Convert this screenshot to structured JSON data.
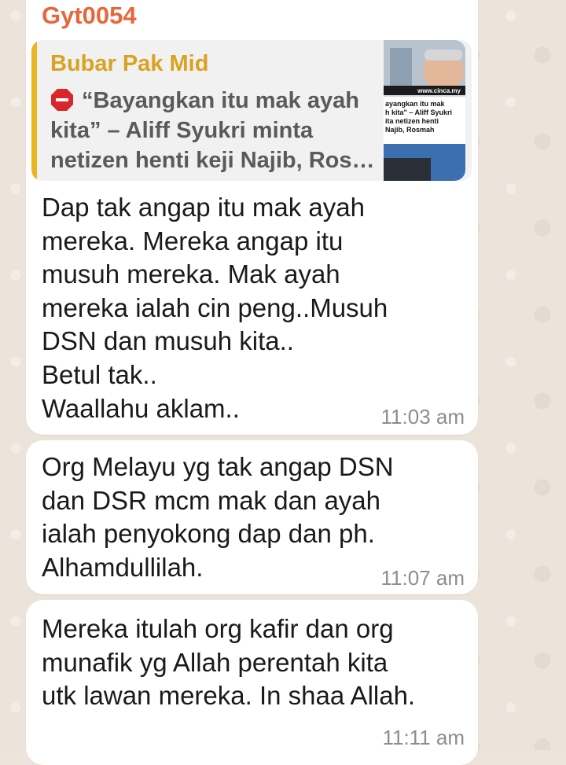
{
  "messages": [
    {
      "sender": "Gyt0054",
      "quote": {
        "author": "Bubar Pak Mid",
        "icon": "stop-sign-icon",
        "text": "“Bayangkan itu mak ayah kita” – Aliff Syukri minta netizen henti keji Najib, Ros…",
        "thumbnail": {
          "site": "www.cinca.my",
          "caption_lines": [
            "ayangkan itu mak",
            "h kita\" – Aliff Syukri",
            "ita netizen henti",
            "Najib, Rosmah"
          ]
        }
      },
      "text": "Dap tak angap itu mak ayah\nmereka. Mereka angap itu\nmusuh mereka. Mak ayah\nmereka ialah cin peng..Musuh\nDSN dan musuh kita..\nBetul tak..\nWaallahu aklam..",
      "time": "11:03 am"
    },
    {
      "text": "Org Melayu yg tak angap DSN\ndan DSR mcm mak dan ayah\nialah penyokong dap dan ph.\nAlhamdullilah.",
      "time": "11:07 am"
    },
    {
      "text": "Mereka itulah org kafir dan org\nmunafik yg Allah perentah kita\nutk lawan mereka. In shaa Allah.",
      "time": "11:11 am"
    }
  ],
  "colors": {
    "sender": "#e8663b",
    "quote_author": "#d9a321",
    "quote_bar": "#e9b520",
    "timestamp": "#8d8d8d"
  }
}
